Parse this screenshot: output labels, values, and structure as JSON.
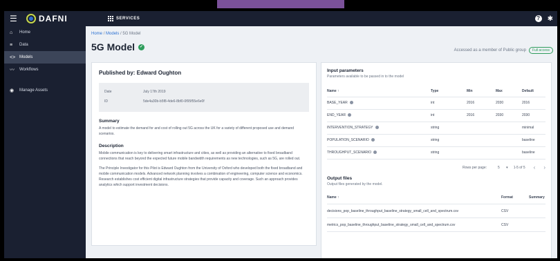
{
  "topbar": {
    "logo_text": "DAFNI",
    "services_label": "SERVICES",
    "help_glyph": "?",
    "icons": [
      "menu-icon",
      "logo-icon",
      "grid-icon",
      "help-icon",
      "gear-icon"
    ]
  },
  "sidebar": {
    "items": [
      {
        "label": "Home",
        "icon": "home-icon",
        "glyph": "⌂"
      },
      {
        "label": "Data",
        "icon": "data-icon",
        "glyph": "≡"
      },
      {
        "label": "Models",
        "icon": "code-icon",
        "glyph": "<>"
      },
      {
        "label": "Workflows",
        "icon": "workflow-icon",
        "glyph": "〰"
      },
      {
        "label": "Manage Assets",
        "icon": "eye-icon",
        "glyph": "◉"
      }
    ]
  },
  "breadcrumb": {
    "home": "Home",
    "models": "Models",
    "current": "5G Model",
    "sep": "/"
  },
  "page": {
    "title": "5G Model",
    "access_text": "Accessed as a member of Public group",
    "access_badge": "Full access"
  },
  "left_card": {
    "published_by": "Published by: Edward Oughton",
    "meta": [
      {
        "key": "Date",
        "value": "July 17th 2019"
      },
      {
        "key": "ID",
        "value": "5de4a30b-b5f8-4de6-8bf0-0f95f55e6e0f"
      }
    ],
    "summary_heading": "Summary",
    "summary_text": "A model to estimate the demand for and cost of rolling out 5G across the UK for a variety of different proposed use and demand scenarios.",
    "description_heading": "Description",
    "description_p1": "Mobile communication is key to delivering smart infrastructure and cities, as well as providing an alternative to fixed broadband connections that reach beyond the expected future mobile bandwidth requirements as new technologies, such as 5G, are rolled out.",
    "description_p2": "The Principle Investigator for this Pilot is Edward Oughton from the University of Oxford who developed both the fixed broadband and mobile communication models. Advanced network planning involves a combination of engineering, computer science and economics. Research establishes cost efficient digital infrastructure strategies that provide capacity and coverage. Such an approach provides analytics which support investment decisions."
  },
  "input_params": {
    "heading": "Input parameters",
    "sub": "Parameters available to be passed in to the model",
    "columns": [
      "Name ↑",
      "Type",
      "Min",
      "Max",
      "Default"
    ],
    "rows": [
      [
        "BASE_YEAR",
        "int",
        "2016",
        "2030",
        "2016"
      ],
      [
        "END_YEAR",
        "int",
        "2016",
        "2030",
        "2030"
      ],
      [
        "INTERVENTION_STRATEGY",
        "string",
        "",
        "",
        "minimal"
      ],
      [
        "POPULATION_SCENARIO",
        "string",
        "",
        "",
        "baseline"
      ],
      [
        "THROUGHPUT_SCENARIO",
        "string",
        "",
        "",
        "baseline"
      ]
    ],
    "pager": {
      "rows_label": "Rows per page:",
      "rows_value": "5",
      "dropdown_glyph": "▾",
      "range": "1-5 of 5",
      "prev_glyph": "‹",
      "next_glyph": "›"
    }
  },
  "output_files": {
    "heading": "Output files",
    "sub": "Output files generated by the model.",
    "columns": [
      "Name ↑",
      "Format",
      "Summary"
    ],
    "rows": [
      [
        "decisions_pop_baseline_throughput_baseline_strategy_small_cell_and_spectrum.csv",
        "CSV",
        ""
      ],
      [
        "metrics_pop_baseline_throughput_baseline_strategy_small_cell_and_spectrum.csv",
        "CSV",
        ""
      ]
    ]
  }
}
